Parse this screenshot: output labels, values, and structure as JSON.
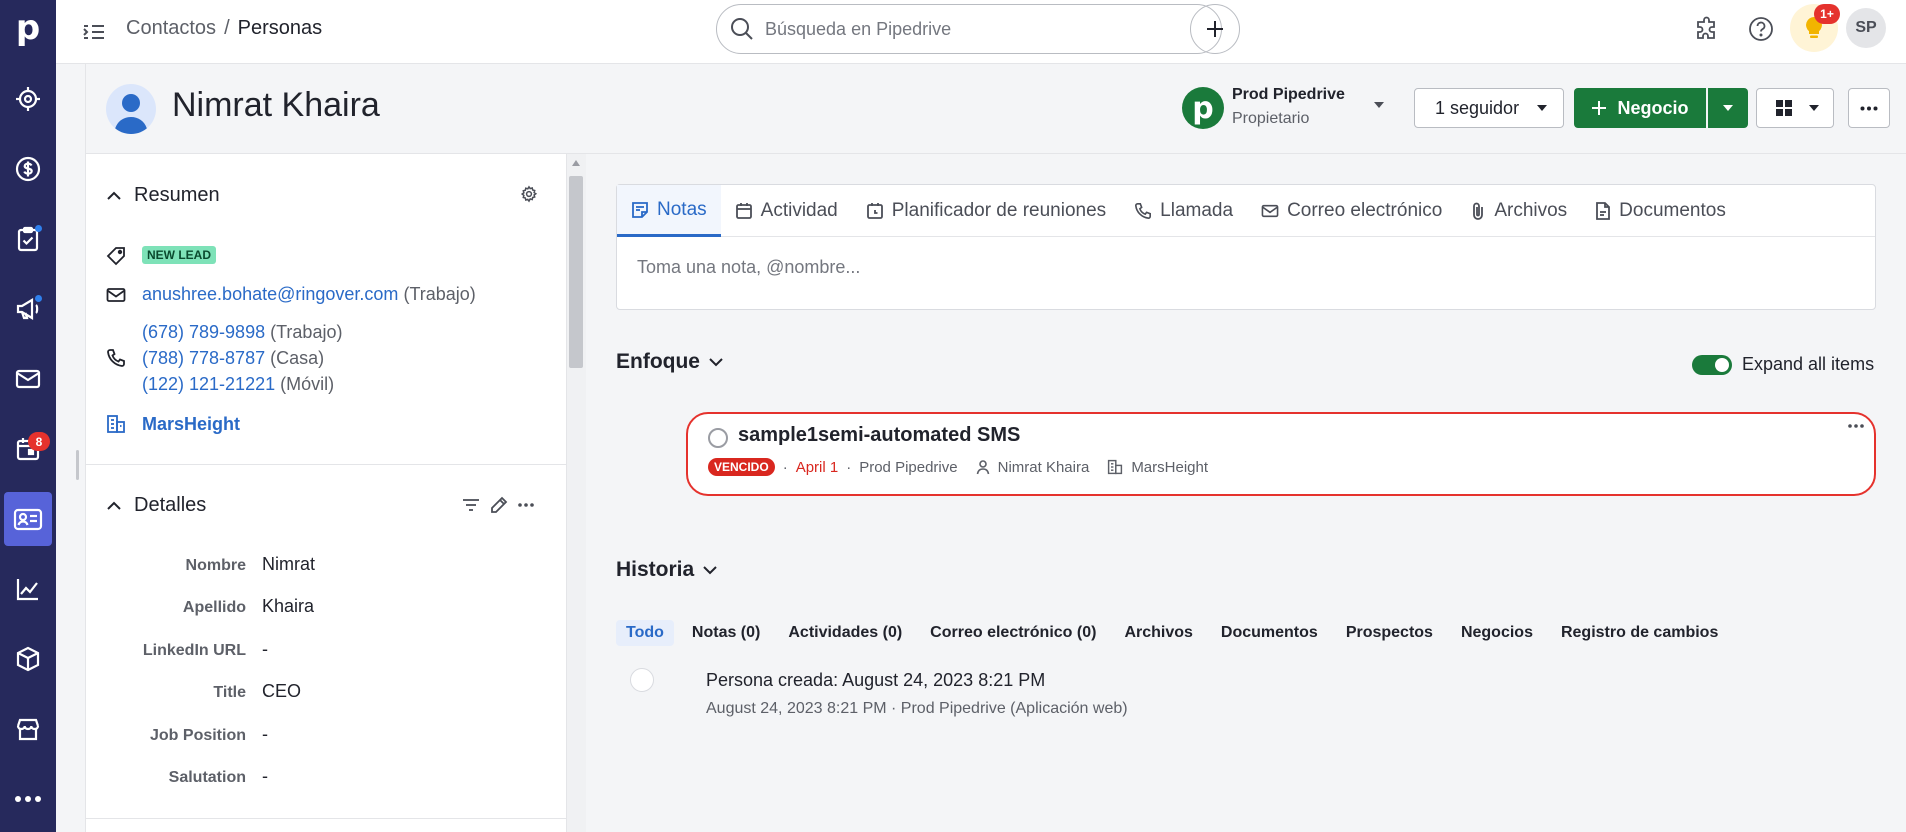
{
  "colors": {
    "rail_bg": "#26295c",
    "rail_active": "#5763d9",
    "brand_green": "#1a7a3b",
    "link_blue": "#2a6ac7",
    "danger_red": "#d9271f",
    "lead_badge_bg": "#7ee2b8"
  },
  "rail": {
    "logo": "p",
    "items": [
      {
        "icon": "target-icon",
        "dot": false,
        "badge": ""
      },
      {
        "icon": "dollar-icon",
        "dot": false,
        "badge": ""
      },
      {
        "icon": "clipboard-check-icon",
        "dot": true,
        "badge": ""
      },
      {
        "icon": "megaphone-icon",
        "dot": true,
        "badge": ""
      },
      {
        "icon": "mail-icon",
        "dot": false,
        "badge": ""
      },
      {
        "icon": "calendar-icon",
        "dot": false,
        "badge": "8"
      },
      {
        "icon": "contact-card-icon",
        "dot": false,
        "badge": "",
        "active": true
      },
      {
        "icon": "chart-line-icon",
        "dot": false,
        "badge": ""
      },
      {
        "icon": "box-icon",
        "dot": false,
        "badge": ""
      },
      {
        "icon": "store-icon",
        "dot": false,
        "badge": ""
      },
      {
        "icon": "more-dots-icon",
        "dot": false,
        "badge": ""
      }
    ]
  },
  "topbar": {
    "breadcrumb_parent": "Contactos",
    "breadcrumb_sep": "/",
    "breadcrumb_current": "Personas",
    "search_placeholder": "Búsqueda en Pipedrive",
    "notif_badge": "1+",
    "user_initials": "SP"
  },
  "person": {
    "name": "Nimrat Khaira",
    "owner_name": "Prod Pipedrive",
    "owner_role": "Propietario",
    "owner_logo": "p",
    "followers_label": "1 seguidor",
    "deal_button": "Negocio"
  },
  "summary": {
    "title": "Resumen",
    "label_tag": "NEW LEAD",
    "email": "anushree.bohate@ringover.com",
    "email_type": "(Trabajo)",
    "phones": [
      {
        "number": "(678) 789-9898",
        "type": "(Trabajo)"
      },
      {
        "number": "(788) 778-8787",
        "type": "(Casa)"
      },
      {
        "number": "(122) 121-21221",
        "type": "(Móvil)"
      }
    ],
    "organization": "MarsHeight"
  },
  "details": {
    "title": "Detalles",
    "fields": [
      {
        "label": "Nombre",
        "value": "Nimrat"
      },
      {
        "label": "Apellido",
        "value": "Khaira"
      },
      {
        "label": "LinkedIn URL",
        "value": "-"
      },
      {
        "label": "Title",
        "value": "CEO"
      },
      {
        "label": "Job Position",
        "value": "-"
      },
      {
        "label": "Salutation",
        "value": "-"
      }
    ]
  },
  "composer": {
    "tabs": [
      {
        "label": "Notas",
        "icon": "note-icon"
      },
      {
        "label": "Actividad",
        "icon": "calendar-icon"
      },
      {
        "label": "Planificador de reuniones",
        "icon": "scheduler-icon"
      },
      {
        "label": "Llamada",
        "icon": "phone-icon"
      },
      {
        "label": "Correo electrónico",
        "icon": "mail-icon"
      },
      {
        "label": "Archivos",
        "icon": "paperclip-icon"
      },
      {
        "label": "Documentos",
        "icon": "document-icon"
      }
    ],
    "note_placeholder": "Toma una nota, @nombre..."
  },
  "focus": {
    "title": "Enfoque",
    "expand_label": "Expand all items",
    "activity": {
      "title": "sample1semi-automated SMS",
      "status": "VENCIDO",
      "sep": "·",
      "date": "April 1",
      "owner": "Prod Pipedrive",
      "person": "Nimrat Khaira",
      "org": "MarsHeight"
    }
  },
  "history": {
    "title": "Historia",
    "filters": [
      "Todo",
      "Notas (0)",
      "Actividades (0)",
      "Correo electrónico (0)",
      "Archivos",
      "Documentos",
      "Prospectos",
      "Negocios",
      "Registro de cambios"
    ],
    "event_title": "Persona creada: August 24, 2023 8:21 PM",
    "event_meta": "August 24, 2023 8:21 PM · Prod Pipedrive (Aplicación web)"
  }
}
